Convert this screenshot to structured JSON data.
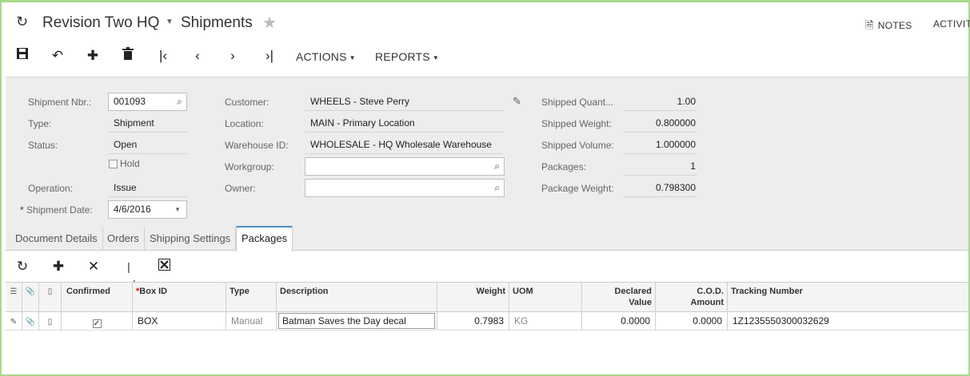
{
  "header": {
    "company": "Revision Two HQ",
    "screen_title": "Shipments",
    "notes_label": "NOTES",
    "activities_label": "ACTIVITIES"
  },
  "toolbar": {
    "actions_label": "ACTIONS",
    "reports_label": "REPORTS"
  },
  "form": {
    "shipment_nbr": {
      "label": "Shipment Nbr.:",
      "value": "001093"
    },
    "type": {
      "label": "Type:",
      "value": "Shipment"
    },
    "status": {
      "label": "Status:",
      "value": "Open"
    },
    "hold": {
      "label": "Hold",
      "checked": false
    },
    "operation": {
      "label": "Operation:",
      "value": "Issue"
    },
    "shipment_date": {
      "label": "Shipment Date:",
      "value": "4/6/2016",
      "required_mark": "*"
    },
    "customer": {
      "label": "Customer:",
      "value": "WHEELS - Steve Perry"
    },
    "location": {
      "label": "Location:",
      "value": "MAIN - Primary Location"
    },
    "warehouse": {
      "label": "Warehouse ID:",
      "value": "WHOLESALE - HQ Wholesale Warehouse"
    },
    "workgroup": {
      "label": "Workgroup:",
      "value": ""
    },
    "owner": {
      "label": "Owner:",
      "value": ""
    },
    "shipped_quantity": {
      "label": "Shipped Quant...",
      "value": "1.00"
    },
    "shipped_weight": {
      "label": "Shipped Weight:",
      "value": "0.800000"
    },
    "shipped_volume": {
      "label": "Shipped Volume:",
      "value": "1.000000"
    },
    "packages": {
      "label": "Packages:",
      "value": "1"
    },
    "package_weight": {
      "label": "Package Weight:",
      "value": "0.798300"
    }
  },
  "tabs": [
    "Document Details",
    "Orders",
    "Shipping Settings",
    "Packages"
  ],
  "active_tab": "Packages",
  "grid": {
    "columns": {
      "confirmed": "Confirmed",
      "box_id": "Box ID",
      "box_id_required": "*",
      "type": "Type",
      "description": "Description",
      "weight": "Weight",
      "uom": "UOM",
      "declared_value_1": "Declared",
      "declared_value_2": "Value",
      "cod_1": "C.O.D.",
      "cod_2": "Amount",
      "tracking": "Tracking Number"
    },
    "rows": [
      {
        "confirmed": true,
        "box_id": "BOX",
        "type": "Manual",
        "description": "Batman Saves the Day decal",
        "weight": "0.7983",
        "uom": "KG",
        "declared_value": "0.0000",
        "cod_amount": "0.0000",
        "tracking_number": "1Z1235550300032629"
      }
    ]
  },
  "colors": {
    "frame_border": "#a8d88a",
    "form_background": "#ededed",
    "active_tab_accent": "#4a90c8"
  }
}
